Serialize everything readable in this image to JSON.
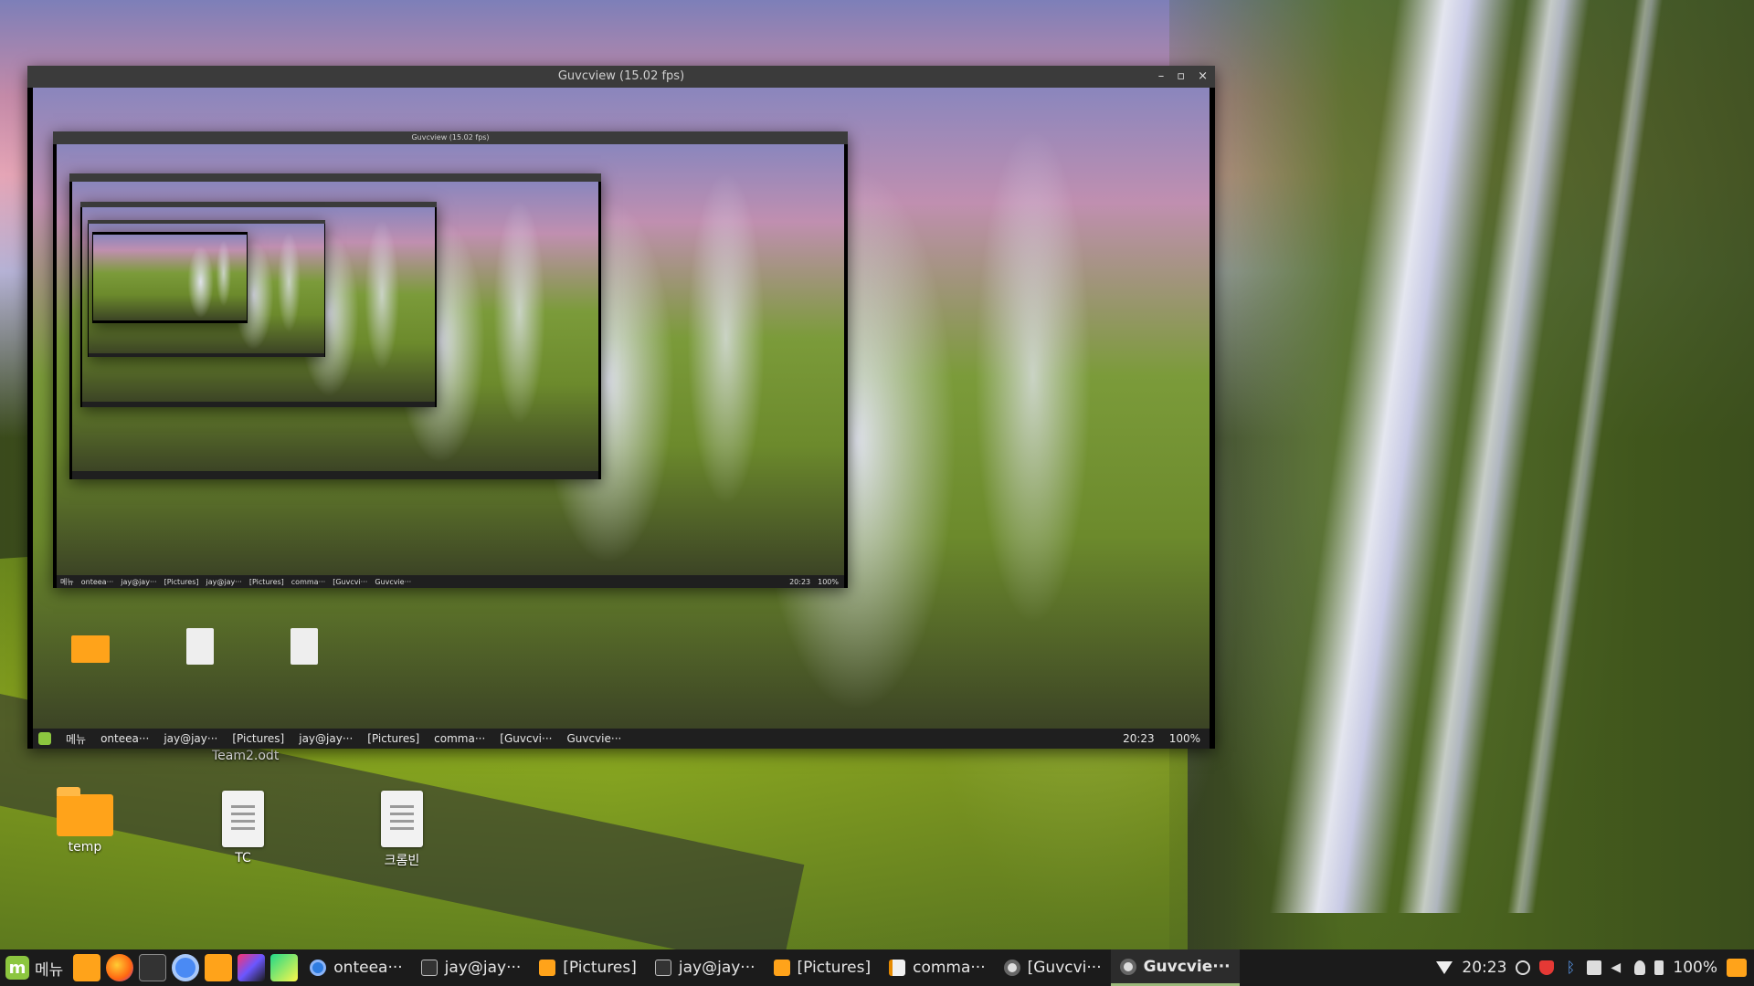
{
  "desktop": {
    "icons": [
      {
        "label": "temp",
        "kind": "folder"
      },
      {
        "label": "TC",
        "kind": "document"
      },
      {
        "label": "크롬빈",
        "kind": "document"
      }
    ],
    "floating_label": "Team2.odt"
  },
  "windows": {
    "main": {
      "title": "Guvcview  (15.02 fps)",
      "controls": [
        "–",
        "▫",
        "×"
      ]
    }
  },
  "nested_taskbar": {
    "menu": "메뉴",
    "tasks": [
      "onteea···",
      "jay@jay···",
      "[Pictures]",
      "jay@jay···",
      "[Pictures]",
      "comma···",
      "[Guvcvi···",
      "Guvcvie···"
    ],
    "clock": "20:23",
    "battery": "100%"
  },
  "taskbar": {
    "menu_label": "메뉴",
    "launchers": [
      "files-icon",
      "firefox-icon",
      "terminal-icon",
      "chromium-icon",
      "folder-icon",
      "intellij-icon",
      "pycharm-icon"
    ],
    "tasks": [
      {
        "label": "onteea···",
        "icon": "chrome",
        "active": false
      },
      {
        "label": "jay@jay···",
        "icon": "term",
        "active": false
      },
      {
        "label": "[Pictures]",
        "icon": "folder",
        "active": false
      },
      {
        "label": "jay@jay···",
        "icon": "term",
        "active": false
      },
      {
        "label": "[Pictures]",
        "icon": "folder",
        "active": false
      },
      {
        "label": "comma···",
        "icon": "edit",
        "active": false
      },
      {
        "label": "[Guvcvi···",
        "icon": "guvc",
        "active": false
      },
      {
        "label": "Guvcvie···",
        "icon": "guvc",
        "active": true
      }
    ],
    "tray": {
      "clock": "20:23",
      "battery": "100%",
      "icons": [
        "network-icon",
        "update-icon",
        "shield-icon",
        "bluetooth-icon",
        "keyboard-icon",
        "volume-muted-icon",
        "user-icon",
        "battery-icon",
        "files-icon"
      ]
    }
  },
  "colors": {
    "taskbar_bg": "#1b1b1b",
    "titlebar_bg": "#3b3b3b",
    "folder": "#ffa31a",
    "mint_green": "#8cc63f"
  }
}
